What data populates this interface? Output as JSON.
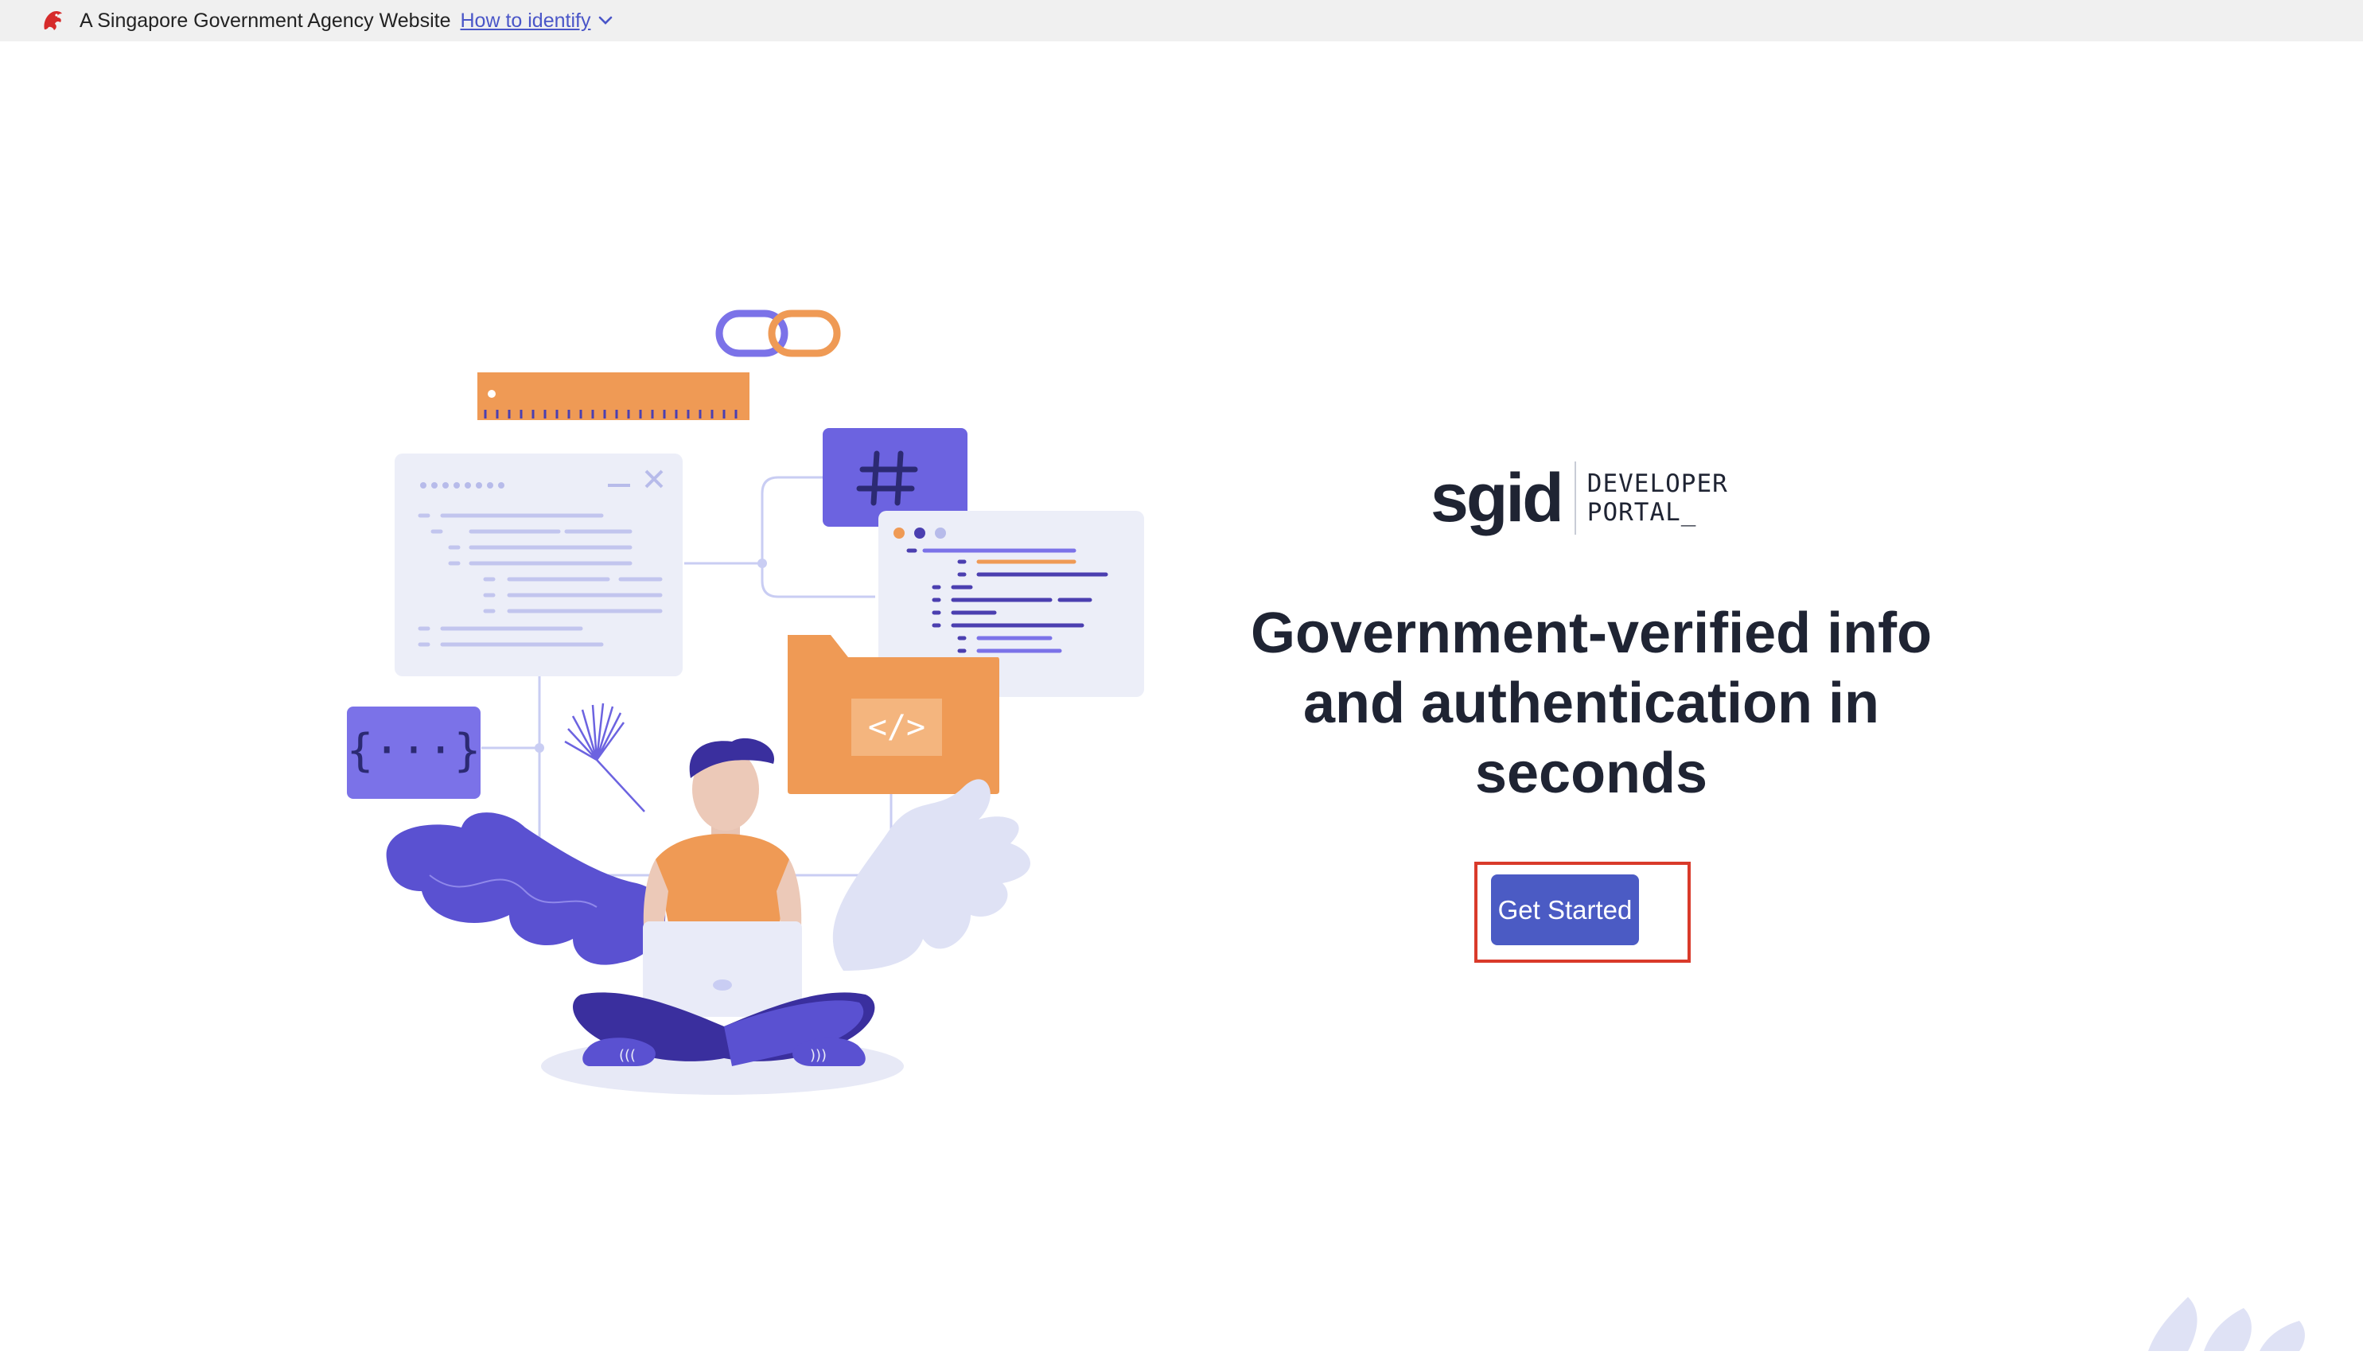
{
  "masthead": {
    "label": "A Singapore Government Agency Website",
    "link": "How to identify",
    "icon": "lion-crest-icon"
  },
  "brand": {
    "wordmark": "sgid",
    "portal_line1": "DEVELOPER",
    "portal_line2": "PORTAL_"
  },
  "hero": {
    "headline_line1": "Government-verified info",
    "headline_line2": "and authentication in",
    "headline_line3": "seconds",
    "cta_label": "Get Started"
  },
  "colors": {
    "primary": "#4b5bc4",
    "accent_orange": "#ef9a55",
    "text": "#1f2433",
    "highlight_frame": "#d93a2a"
  }
}
